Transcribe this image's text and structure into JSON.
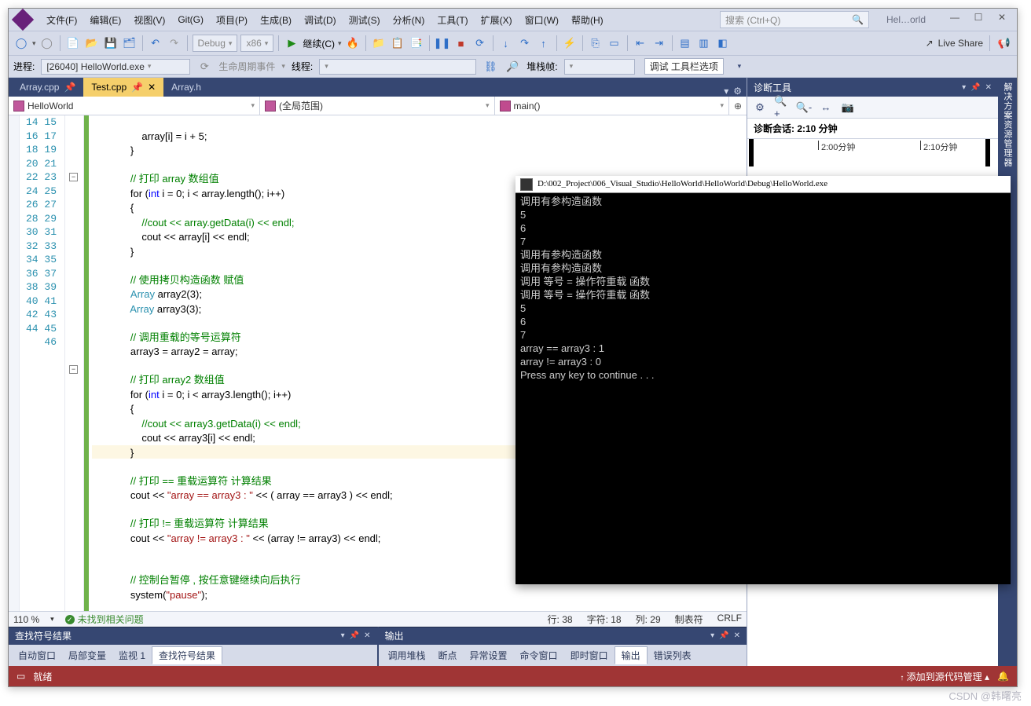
{
  "menu": {
    "file": "文件(F)",
    "edit": "编辑(E)",
    "view": "视图(V)",
    "git": "Git(G)",
    "project": "项目(P)",
    "build": "生成(B)",
    "debug": "调试(D)",
    "test": "测试(S)",
    "analyze": "分析(N)",
    "tools": "工具(T)",
    "extensions": "扩展(X)",
    "window": "窗口(W)",
    "help": "帮助(H)"
  },
  "search_placeholder": "搜索 (Ctrl+Q)",
  "title_chip": "Hel…orld",
  "toolbar": {
    "config": "Debug",
    "platform": "x86",
    "continue": "继续(C)",
    "live": "Live Share"
  },
  "toolbar2": {
    "process_label": "进程:",
    "process_value": "[26040] HelloWorld.exe",
    "lifecycle": "生命周期事件",
    "thread_label": "线程:",
    "stackframe_label": "堆栈帧:",
    "tooltip": "调试 工具栏选项"
  },
  "tabs": [
    {
      "name": "Array.cpp",
      "pinned": true
    },
    {
      "name": "Test.cpp",
      "active": true,
      "dirty": true
    },
    {
      "name": "Array.h"
    }
  ],
  "nav": {
    "project": "HelloWorld",
    "scope": "(全局范围)",
    "func": "main()"
  },
  "lines": [
    "14",
    "15",
    "16",
    "17",
    "18",
    "19",
    "20",
    "21",
    "22",
    "23",
    "24",
    "25",
    "26",
    "27",
    "28",
    "29",
    "30",
    "31",
    "32",
    "33",
    "34",
    "35",
    "36",
    "37",
    "38",
    "39",
    "40",
    "41",
    "42",
    "43",
    "44",
    "45",
    "46"
  ],
  "code": {
    "c14": "            array[i] = i + 5;",
    "c15": "        }",
    "c17": "        // 打印 array 数组值",
    "c18a": "        for (",
    "c18b": "int",
    "c18c": " i = 0; i < array.length(); i++)",
    "c19": "        {",
    "c20": "            //cout << array.getData(i) << endl;",
    "c21": "            cout << array[i] << endl;",
    "c22": "        }",
    "c24": "        // 使用拷贝构造函数 赋值",
    "c25a": "        ",
    "c25b": "Array",
    "c25c": " array2(3);",
    "c26a": "        ",
    "c26b": "Array",
    "c26c": " array3(3);",
    "c28": "        // 调用重载的等号运算符",
    "c29": "        array3 = array2 = array;",
    "c31": "        // 打印 array2 数组值",
    "c32a": "        for (",
    "c32b": "int",
    "c32c": " i = 0; i < array3.length(); i++)",
    "c33": "        {",
    "c34": "            //cout << array3.getData(i) << endl;",
    "c35": "            cout << array3[i] << endl;",
    "c36": "        }",
    "c38": "        // 打印 == 重载运算符 计算结果",
    "c39a": "        cout << ",
    "c39b": "\"array == array3 : \"",
    "c39c": " << ( array == array3 ) << endl;",
    "c41": "        // 打印 != 重载运算符 计算结果",
    "c42a": "        cout << ",
    "c42b": "\"array != array3 : \"",
    "c42c": " << (array != array3) << endl;",
    "c45": "        // 控制台暂停 , 按任意键继续向后执行",
    "c46a": "        system(",
    "c46b": "\"pause\"",
    "c46c": ");"
  },
  "zoom": "110 %",
  "no_issue": "未找到相关问题",
  "cursor": {
    "line": "行: 38",
    "col": "字符: 18",
    "column": "列: 29",
    "tab": "制表符",
    "crlf": "CRLF"
  },
  "diag": {
    "title": "诊断工具",
    "session": "诊断会话: 2:10 分钟",
    "t1": "2:00分钟",
    "t2": "2:10分钟"
  },
  "side_panel": "解决方案资源管理器",
  "panels": {
    "symbols": "查找符号结果",
    "output": "输出"
  },
  "bottom_tabs_left": {
    "auto": "自动窗口",
    "locals": "局部变量",
    "watch": "监视 1",
    "symbols": "查找符号结果"
  },
  "bottom_tabs_right": {
    "callstack": "调用堆栈",
    "bp": "断点",
    "exc": "异常设置",
    "cmd": "命令窗口",
    "imm": "即时窗口",
    "out": "输出",
    "err": "错误列表"
  },
  "status": {
    "ready": "就绪",
    "add_src": "添加到源代码管理"
  },
  "console": {
    "title": "D:\\002_Project\\006_Visual_Studio\\HelloWorld\\HelloWorld\\Debug\\HelloWorld.exe",
    "text": "调用有参构造函数\n5\n6\n7\n调用有参构造函数\n调用有参构造函数\n调用 等号 = 操作符重载 函数\n调用 等号 = 操作符重载 函数\n5\n6\n7\narray == array3 : 1\narray != array3 : 0\nPress any key to continue . . ."
  },
  "watermark": "CSDN @韩曙亮"
}
